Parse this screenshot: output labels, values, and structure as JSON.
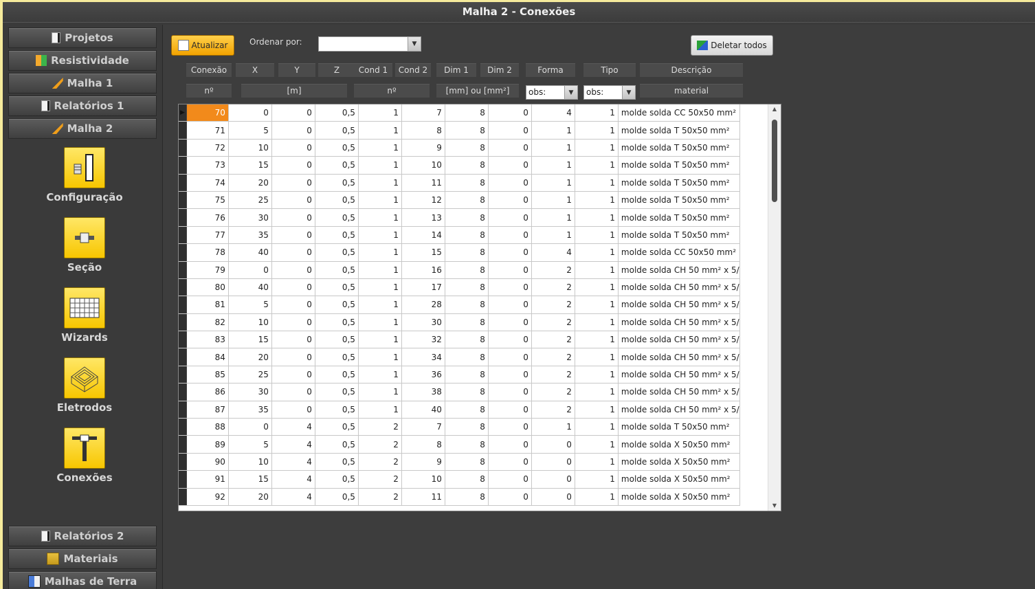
{
  "window": {
    "title": "Malha 2 - Conexões"
  },
  "sidebar": {
    "top_items": [
      {
        "label": "Projetos",
        "icon": "document-icon"
      },
      {
        "label": "Resistividade",
        "icon": "resistivity-icon"
      },
      {
        "label": "Malha 1",
        "icon": "mesh-icon"
      },
      {
        "label": "Relatórios 1",
        "icon": "document-icon"
      },
      {
        "label": "Malha 2",
        "icon": "mesh-icon"
      }
    ],
    "tools": [
      {
        "label": "Configuração",
        "icon": "configuration-icon"
      },
      {
        "label": "Seção",
        "icon": "section-icon"
      },
      {
        "label": "Wizards",
        "icon": "wizard-grid-icon"
      },
      {
        "label": "Eletrodos",
        "icon": "electrodes-icon"
      },
      {
        "label": "Conexões",
        "icon": "connection-icon"
      }
    ],
    "bottom_items": [
      {
        "label": "Relatórios 2",
        "icon": "document-icon"
      },
      {
        "label": "Materiais",
        "icon": "materials-icon"
      },
      {
        "label": "Malhas de Terra",
        "icon": "earth-mesh-icon"
      }
    ]
  },
  "toolbar": {
    "refresh_label": "Atualizar",
    "sort_label": "Ordenar por:",
    "sort_value": "",
    "delete_all_label": "Deletar todos"
  },
  "columns": {
    "headers": [
      "Conexão",
      "X",
      "Y",
      "Z",
      "Cond 1",
      "Cond 2",
      "Dim 1",
      "Dim 2",
      "Forma",
      "Tipo",
      "Descrição"
    ],
    "units": {
      "n1": "nº",
      "xyz": "[m]",
      "n2": "nº",
      "dim": "[mm] ou [mm²]",
      "forma_filter": "obs:",
      "tipo_filter": "obs:",
      "material": "material"
    }
  },
  "rows": [
    [
      "70",
      "0",
      "0",
      "0,5",
      "1",
      "7",
      "8",
      "0",
      "4",
      "1",
      "molde solda CC 50x50 mm²"
    ],
    [
      "71",
      "5",
      "0",
      "0,5",
      "1",
      "8",
      "8",
      "0",
      "1",
      "1",
      "molde solda T 50x50 mm²"
    ],
    [
      "72",
      "10",
      "0",
      "0,5",
      "1",
      "9",
      "8",
      "0",
      "1",
      "1",
      "molde solda T 50x50 mm²"
    ],
    [
      "73",
      "15",
      "0",
      "0,5",
      "1",
      "10",
      "8",
      "0",
      "1",
      "1",
      "molde solda T 50x50 mm²"
    ],
    [
      "74",
      "20",
      "0",
      "0,5",
      "1",
      "11",
      "8",
      "0",
      "1",
      "1",
      "molde solda T 50x50 mm²"
    ],
    [
      "75",
      "25",
      "0",
      "0,5",
      "1",
      "12",
      "8",
      "0",
      "1",
      "1",
      "molde solda T 50x50 mm²"
    ],
    [
      "76",
      "30",
      "0",
      "0,5",
      "1",
      "13",
      "8",
      "0",
      "1",
      "1",
      "molde solda T 50x50 mm²"
    ],
    [
      "77",
      "35",
      "0",
      "0,5",
      "1",
      "14",
      "8",
      "0",
      "1",
      "1",
      "molde solda T 50x50 mm²"
    ],
    [
      "78",
      "40",
      "0",
      "0,5",
      "1",
      "15",
      "8",
      "0",
      "4",
      "1",
      "molde solda CC 50x50 mm²"
    ],
    [
      "79",
      "0",
      "0",
      "0,5",
      "1",
      "16",
      "8",
      "0",
      "2",
      "1",
      "molde solda CH 50 mm² x 5/"
    ],
    [
      "80",
      "40",
      "0",
      "0,5",
      "1",
      "17",
      "8",
      "0",
      "2",
      "1",
      "molde solda CH 50 mm² x 5/"
    ],
    [
      "81",
      "5",
      "0",
      "0,5",
      "1",
      "28",
      "8",
      "0",
      "2",
      "1",
      "molde solda CH 50 mm² x 5/"
    ],
    [
      "82",
      "10",
      "0",
      "0,5",
      "1",
      "30",
      "8",
      "0",
      "2",
      "1",
      "molde solda CH 50 mm² x 5/"
    ],
    [
      "83",
      "15",
      "0",
      "0,5",
      "1",
      "32",
      "8",
      "0",
      "2",
      "1",
      "molde solda CH 50 mm² x 5/"
    ],
    [
      "84",
      "20",
      "0",
      "0,5",
      "1",
      "34",
      "8",
      "0",
      "2",
      "1",
      "molde solda CH 50 mm² x 5/"
    ],
    [
      "85",
      "25",
      "0",
      "0,5",
      "1",
      "36",
      "8",
      "0",
      "2",
      "1",
      "molde solda CH 50 mm² x 5/"
    ],
    [
      "86",
      "30",
      "0",
      "0,5",
      "1",
      "38",
      "8",
      "0",
      "2",
      "1",
      "molde solda CH 50 mm² x 5/"
    ],
    [
      "87",
      "35",
      "0",
      "0,5",
      "1",
      "40",
      "8",
      "0",
      "2",
      "1",
      "molde solda CH 50 mm² x 5/"
    ],
    [
      "88",
      "0",
      "4",
      "0,5",
      "2",
      "7",
      "8",
      "0",
      "1",
      "1",
      "molde solda T 50x50 mm²"
    ],
    [
      "89",
      "5",
      "4",
      "0,5",
      "2",
      "8",
      "8",
      "0",
      "0",
      "1",
      "molde solda X 50x50 mm²"
    ],
    [
      "90",
      "10",
      "4",
      "0,5",
      "2",
      "9",
      "8",
      "0",
      "0",
      "1",
      "molde solda X 50x50 mm²"
    ],
    [
      "91",
      "15",
      "4",
      "0,5",
      "2",
      "10",
      "8",
      "0",
      "0",
      "1",
      "molde solda X 50x50 mm²"
    ],
    [
      "92",
      "20",
      "4",
      "0,5",
      "2",
      "11",
      "8",
      "0",
      "0",
      "1",
      "molde solda X 50x50 mm²"
    ]
  ],
  "selected_row_index": 0,
  "colors": {
    "accent": "#f28a1b",
    "tool_yellow": "#f7c600",
    "background": "#3a3a3a"
  }
}
